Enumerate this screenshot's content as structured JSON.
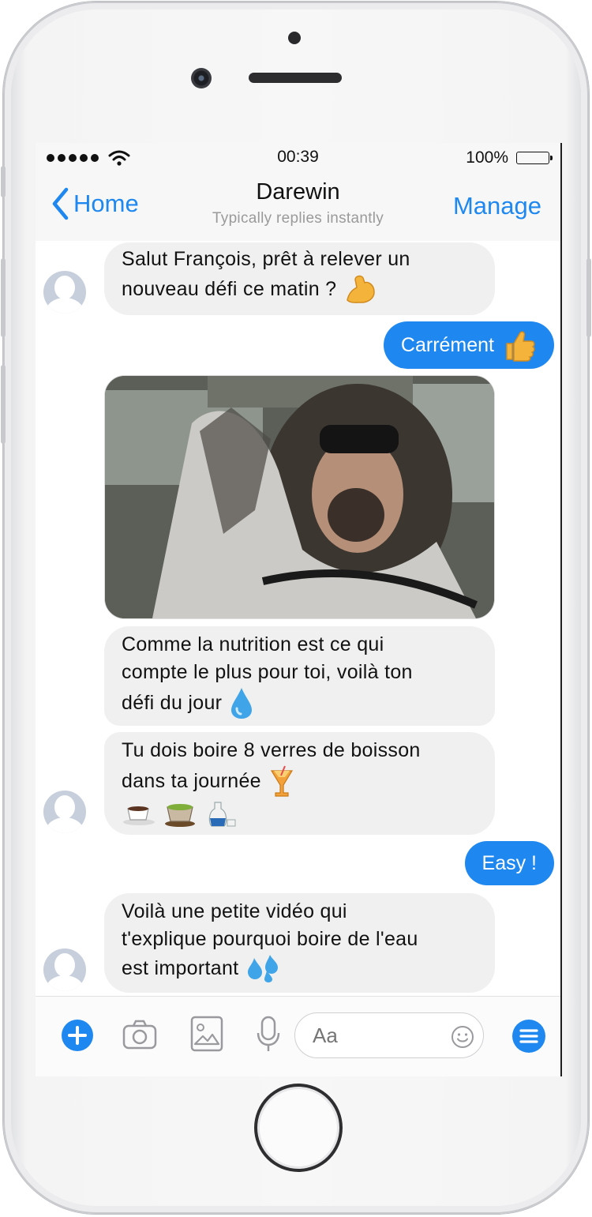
{
  "status_bar": {
    "time": "00:39",
    "battery": "100%"
  },
  "header": {
    "back_label": "Home",
    "title": "Darewin",
    "subtitle": "Typically replies instantly",
    "manage_label": "Manage"
  },
  "messages": [
    {
      "from": "bot",
      "line1": "Salut François, prêt à relever un",
      "line2": "nouveau défi ce matin ?"
    },
    {
      "from": "user",
      "text": "Carrément"
    },
    {
      "from": "bot",
      "type": "image"
    },
    {
      "from": "bot",
      "line1": "Comme la nutrition est ce qui",
      "line2": "compte le plus pour toi, voilà ton",
      "line3": "défi du jour"
    },
    {
      "from": "bot",
      "line1": "Tu dois boire 8 verres de boisson",
      "line2": "dans ta journée"
    },
    {
      "from": "user",
      "text": "Easy !"
    },
    {
      "from": "bot",
      "line1": "Voilà une petite vidéo qui",
      "line2": "t'explique pourquoi boire de l'eau",
      "line3": "est important"
    }
  ],
  "composer": {
    "placeholder": "Aa"
  },
  "colors": {
    "accent": "#1e88f0",
    "incoming_bubble": "#f1f0f0"
  }
}
